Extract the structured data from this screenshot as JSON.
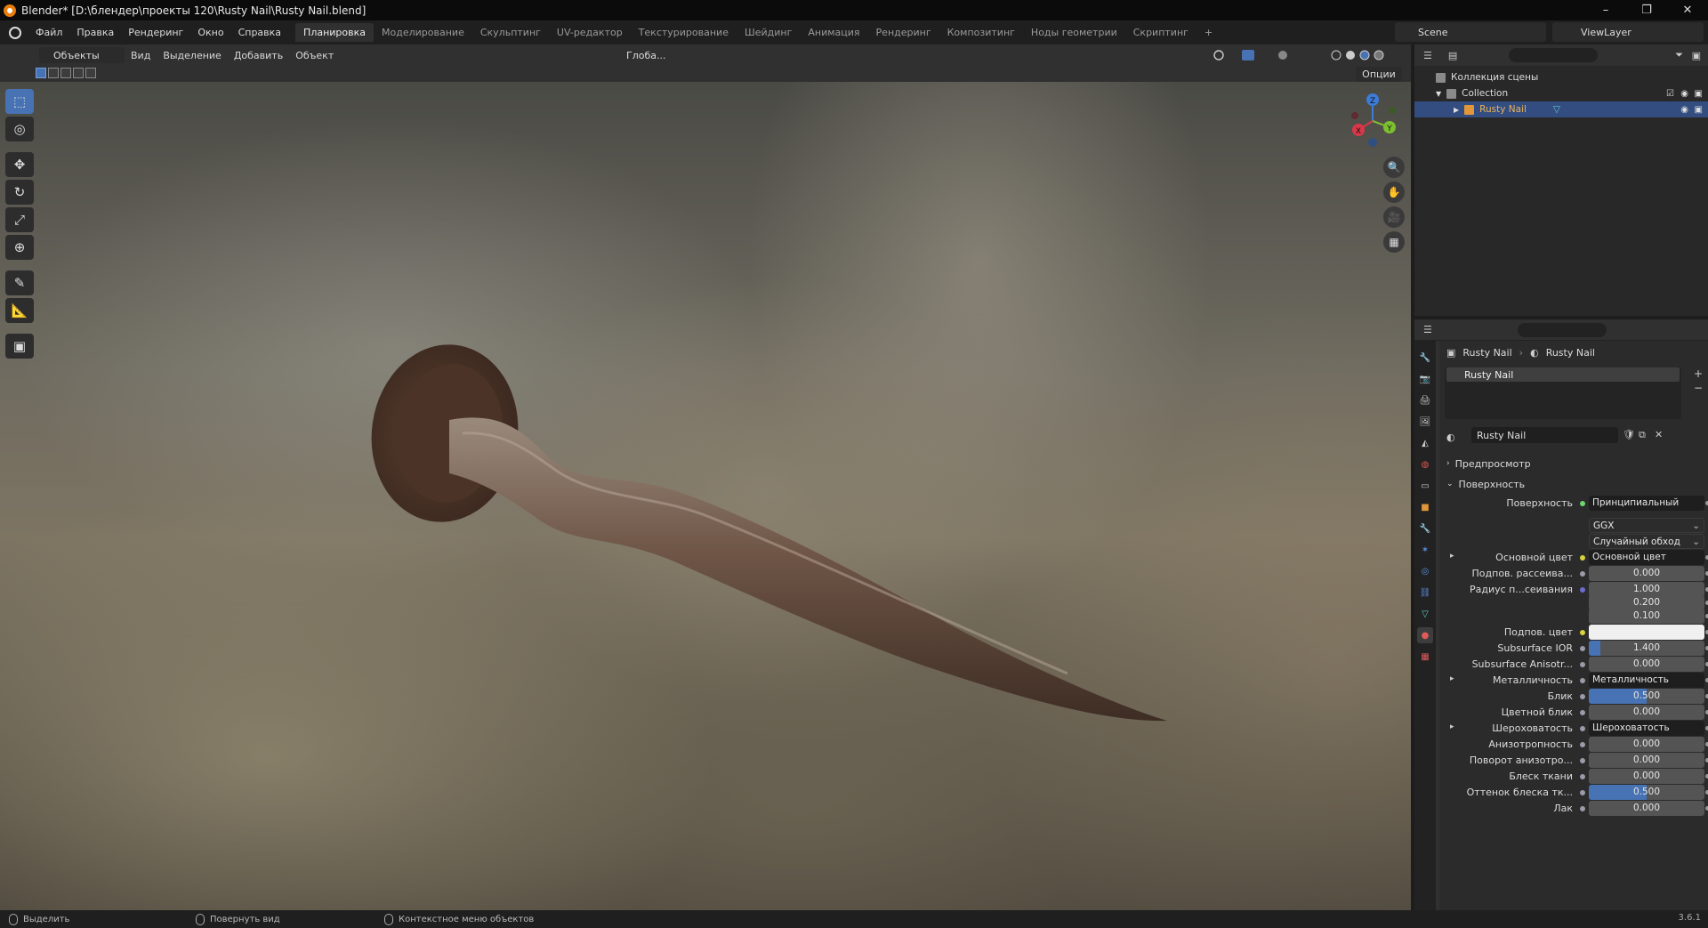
{
  "window": {
    "title": "Blender* [D:\\блендер\\проекты 120\\Rusty Nail\\Rusty Nail.blend]",
    "min": "–",
    "max": "❐",
    "close": "✕"
  },
  "menu": [
    "Файл",
    "Правка",
    "Рендеринг",
    "Окно",
    "Справка"
  ],
  "workspaces": [
    {
      "label": "Планировка",
      "active": true
    },
    {
      "label": "Моделирование"
    },
    {
      "label": "Скульптинг"
    },
    {
      "label": "UV-редактор"
    },
    {
      "label": "Текстурирование"
    },
    {
      "label": "Шейдинг"
    },
    {
      "label": "Анимация"
    },
    {
      "label": "Рендеринг"
    },
    {
      "label": "Композитинг"
    },
    {
      "label": "Ноды геометрии"
    },
    {
      "label": "Скриптинг"
    }
  ],
  "add_workspace": "+",
  "scene": "Scene",
  "viewlayer": "ViewLayer",
  "viewport_header": {
    "mode": "Объекты",
    "menus": [
      "Вид",
      "Выделение",
      "Добавить",
      "Объект"
    ],
    "orientation": "Глоба...",
    "options": "Опции"
  },
  "gizmo": {
    "x": "X",
    "y": "Y",
    "z": "Z"
  },
  "outliner": {
    "root": "Коллекция сцены",
    "collection": "Collection",
    "object": "Rusty Nail"
  },
  "properties": {
    "breadcrumb": [
      "Rusty Nail",
      "Rusty Nail"
    ],
    "slot": "Rusty Nail",
    "material": "Rusty Nail",
    "panels": {
      "preview": "Предпросмотр",
      "surface": "Поверхность"
    },
    "rows": [
      {
        "label": "Поверхность",
        "value": "Принципиальный BSDF",
        "kind": "link",
        "dot": "#6fd46f"
      },
      {
        "label": "",
        "value": "GGX",
        "kind": "drop"
      },
      {
        "label": "",
        "value": "Случайный обход",
        "kind": "drop"
      },
      {
        "label": "Основной цвет",
        "value": "Основной цвет",
        "kind": "link",
        "dot": "#d8d23c",
        "expand": true
      },
      {
        "label": "Подпов. рассеива...",
        "value": "0.000",
        "kind": "num",
        "dot": "#9a9aa8"
      },
      {
        "label": "Радиус п...сеивания",
        "value": "1.000",
        "kind": "num",
        "dot": "#6c6cd0"
      },
      {
        "label": "",
        "value": "0.200",
        "kind": "num"
      },
      {
        "label": "",
        "value": "0.100",
        "kind": "num"
      },
      {
        "label": "Подпов. цвет",
        "value": "",
        "kind": "white",
        "dot": "#d8d23c"
      },
      {
        "label": "Subsurface IOR",
        "value": "1.400",
        "kind": "num",
        "dot": "#9a9aa8",
        "fill": 0.1
      },
      {
        "label": "Subsurface Anisotr...",
        "value": "0.000",
        "kind": "num",
        "dot": "#9a9aa8"
      },
      {
        "label": "Металличность",
        "value": "Металличность",
        "kind": "link",
        "dot": "#9a9aa8",
        "expand": true
      },
      {
        "label": "Блик",
        "value": "0.500",
        "kind": "num",
        "dot": "#9a9aa8",
        "fill": 0.5
      },
      {
        "label": "Цветной блик",
        "value": "0.000",
        "kind": "num",
        "dot": "#9a9aa8"
      },
      {
        "label": "Шероховатость",
        "value": "Шероховатость",
        "kind": "link",
        "dot": "#9a9aa8",
        "expand": true
      },
      {
        "label": "Анизотропность",
        "value": "0.000",
        "kind": "num",
        "dot": "#9a9aa8"
      },
      {
        "label": "Поворот анизотро...",
        "value": "0.000",
        "kind": "num",
        "dot": "#9a9aa8"
      },
      {
        "label": "Блеск ткани",
        "value": "0.000",
        "kind": "num",
        "dot": "#9a9aa8"
      },
      {
        "label": "Оттенок блеска тк...",
        "value": "0.500",
        "kind": "num",
        "dot": "#9a9aa8",
        "fill": 0.5
      },
      {
        "label": "Лак",
        "value": "0.000",
        "kind": "num",
        "dot": "#9a9aa8"
      }
    ]
  },
  "status": {
    "select": "Выделить",
    "rotate": "Повернуть вид",
    "context": "Контекстное меню объектов",
    "version": "3.6.1"
  }
}
